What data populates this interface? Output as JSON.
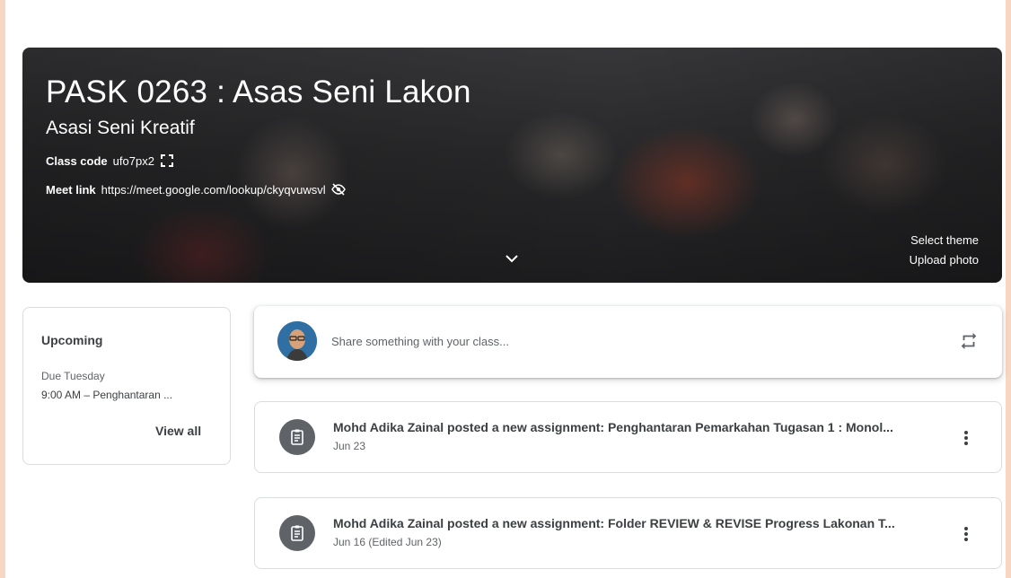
{
  "banner": {
    "title": "PASK 0263 : Asas Seni Lakon",
    "subtitle": "Asasi Seni Kreatif",
    "class_code_label": "Class code",
    "class_code_value": "ufo7px2",
    "meet_label": "Meet link",
    "meet_value": "https://meet.google.com/lookup/ckyqvuwsvl",
    "select_theme": "Select theme",
    "upload_photo": "Upload photo"
  },
  "upcoming": {
    "title": "Upcoming",
    "due": "Due Tuesday",
    "item": "9:00 AM – Penghantaran ...",
    "view_all": "View all"
  },
  "share": {
    "placeholder": "Share something with your class..."
  },
  "stream": [
    {
      "title": "Mohd Adika Zainal posted a new assignment: Penghantaran Pemarkahan Tugasan 1 : Monol...",
      "date": "Jun 23"
    },
    {
      "title": "Mohd Adika Zainal posted a new assignment: Folder REVIEW & REVISE Progress Lakonan T...",
      "date": "Jun 16 (Edited Jun 23)"
    }
  ],
  "colors": {
    "background": "#f7d6c3",
    "icon_bg": "#5f6368",
    "text_primary": "#3c4043"
  }
}
